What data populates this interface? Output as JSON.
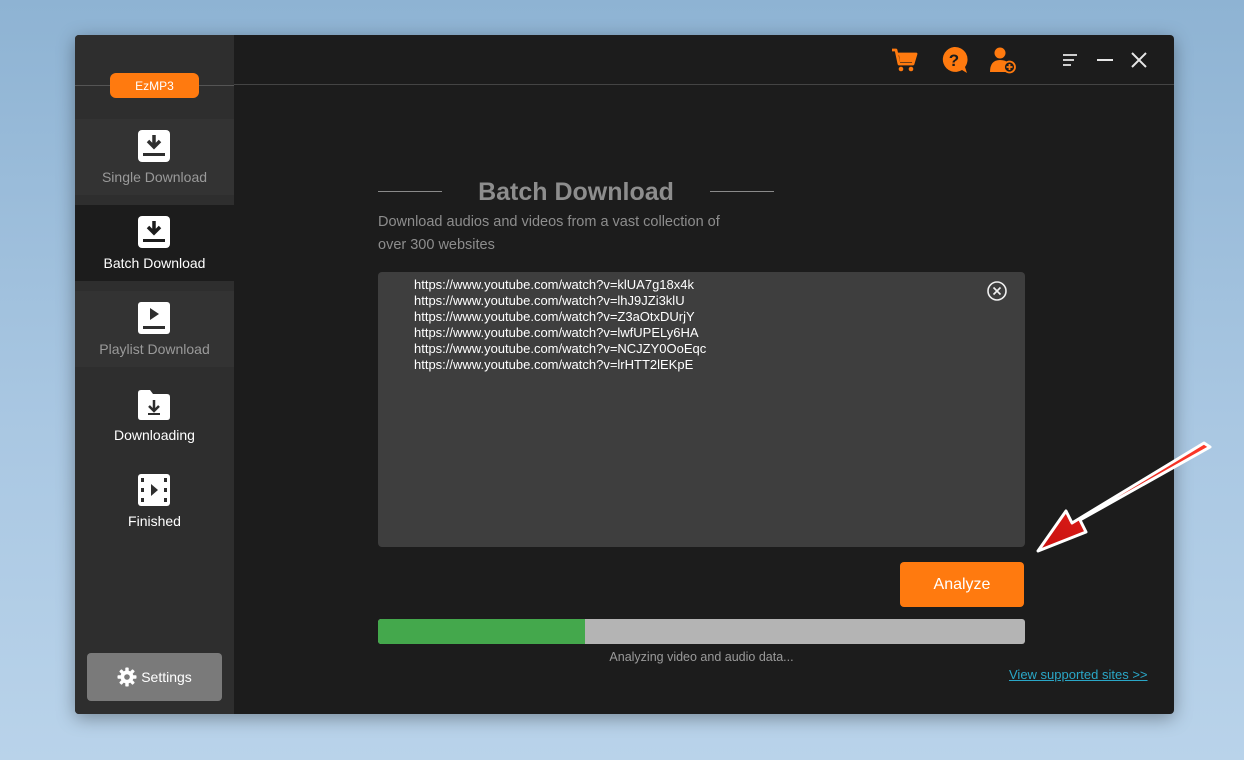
{
  "app": {
    "brand": "EzMP3"
  },
  "sidebar": {
    "items": [
      {
        "label": "Single Download",
        "icon": "download-tray-icon"
      },
      {
        "label": "Batch Download",
        "icon": "download-tray-icon",
        "active": true
      },
      {
        "label": "Playlist Download",
        "icon": "playlist-play-icon"
      },
      {
        "label": "Downloading",
        "icon": "folder-download-icon"
      },
      {
        "label": "Finished",
        "icon": "film-play-icon"
      }
    ],
    "settings_label": "Settings"
  },
  "toolbar": {
    "icons": [
      "cart-icon",
      "help-icon",
      "user-add-icon",
      "menu-icon",
      "minimize-icon",
      "close-icon"
    ]
  },
  "main": {
    "title": "Batch Download",
    "subtitle_line1": "Download audios and videos from a vast collection of",
    "subtitle_line2": "over 300 websites",
    "urls": [
      "https://www.youtube.com/watch?v=klUA7g18x4k",
      "https://www.youtube.com/watch?v=lhJ9JZi3klU",
      "https://www.youtube.com/watch?v=Z3aOtxDUrjY",
      "https://www.youtube.com/watch?v=lwfUPELy6HA",
      "https://www.youtube.com/watch?v=NCJZY0OoEqc",
      "https://www.youtube.com/watch?v=lrHTT2lEKpE"
    ],
    "analyze_label": "Analyze",
    "progress_fraction": 0.32,
    "status_text": "Analyzing video and audio data...",
    "sites_link": "View supported sites >>"
  },
  "colors": {
    "accent": "#ff7a0f",
    "progress_fill": "#44a84c",
    "link": "#2aa7c7",
    "annotation_arrow": "#e51616"
  }
}
